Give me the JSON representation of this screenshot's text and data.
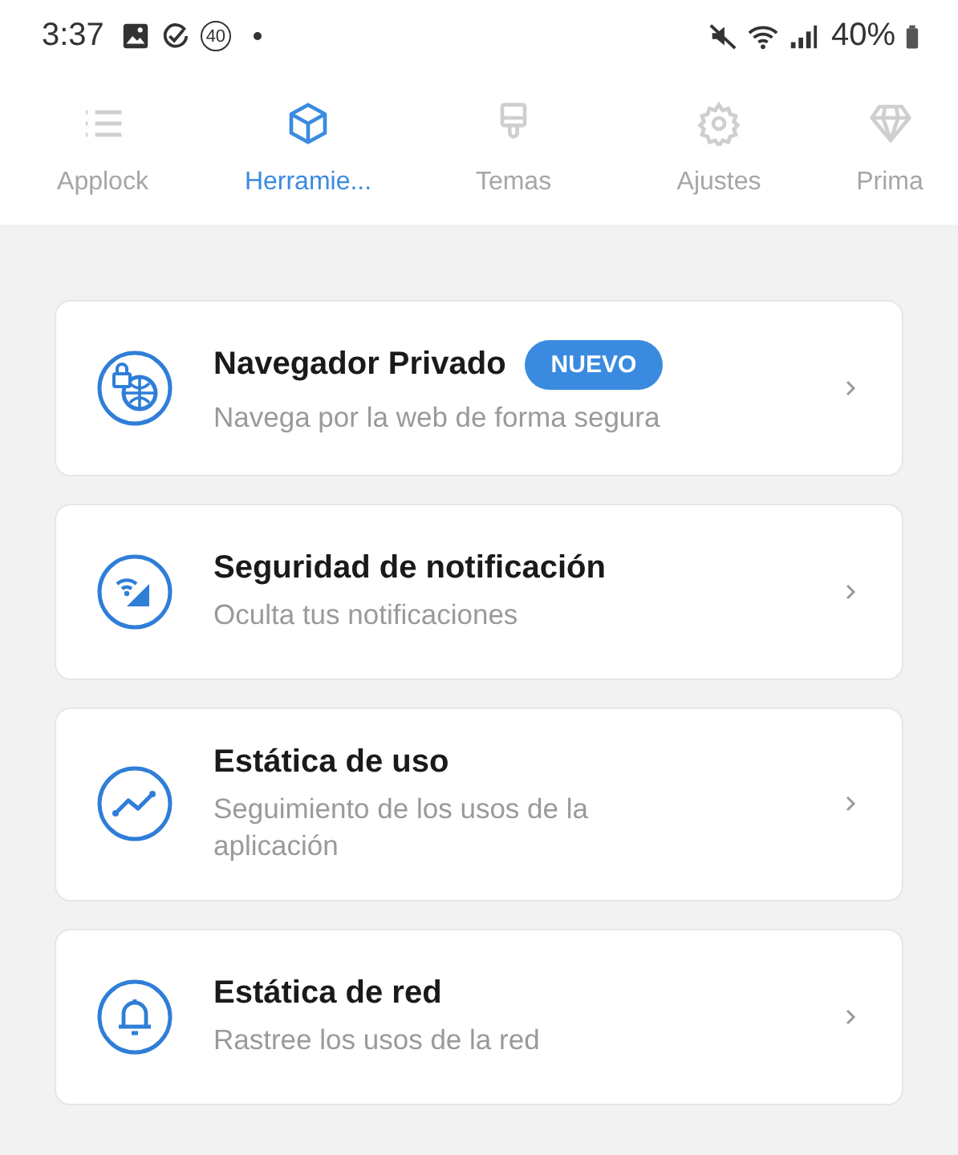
{
  "status_bar": {
    "time": "3:37",
    "badge": "40",
    "battery": "40%"
  },
  "tabs": [
    {
      "label": "Applock",
      "selected": false
    },
    {
      "label": "Herramie...",
      "selected": true
    },
    {
      "label": "Temas",
      "selected": false
    },
    {
      "label": "Ajustes",
      "selected": false
    },
    {
      "label": "Prima",
      "selected": false
    }
  ],
  "tools": [
    {
      "title": "Navegador Privado",
      "badge": "NUEVO",
      "subtitle": "Navega por la web de forma segura"
    },
    {
      "title": "Seguridad de notificación",
      "subtitle": "Oculta tus notificaciones"
    },
    {
      "title": "Estática de uso",
      "subtitle": "Seguimiento de los usos de la aplicación"
    },
    {
      "title": "Estática de red",
      "subtitle": "Rastree los usos de la red"
    }
  ]
}
